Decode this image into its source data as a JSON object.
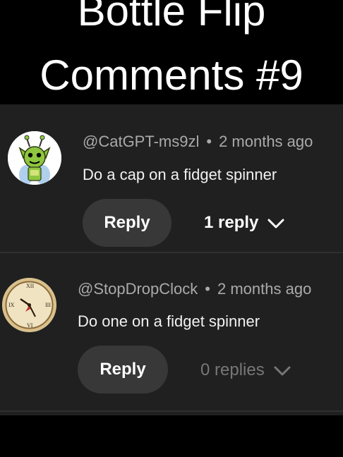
{
  "title": {
    "line1": "Bottle Flip",
    "line2": "Comments #9"
  },
  "comments": [
    {
      "author": "@CatGPT-ms9zl",
      "separator": "•",
      "time": "2 months ago",
      "text": "Do a cap on a fidget spinner",
      "reply_label": "Reply",
      "replies_label": "1 reply",
      "avatar_icon": "green-goblin-avatar-icon"
    },
    {
      "author": "@StopDropClock",
      "separator": "•",
      "time": "2 months ago",
      "text": "Do one on a fidget spinner",
      "reply_label": "Reply",
      "replies_label": "0 replies",
      "avatar_icon": "clock-avatar-icon"
    }
  ],
  "colors": {
    "panel_bg": "#202020",
    "button_bg": "#383838",
    "meta_text": "#aaaaaa",
    "disabled_text": "#777777"
  }
}
